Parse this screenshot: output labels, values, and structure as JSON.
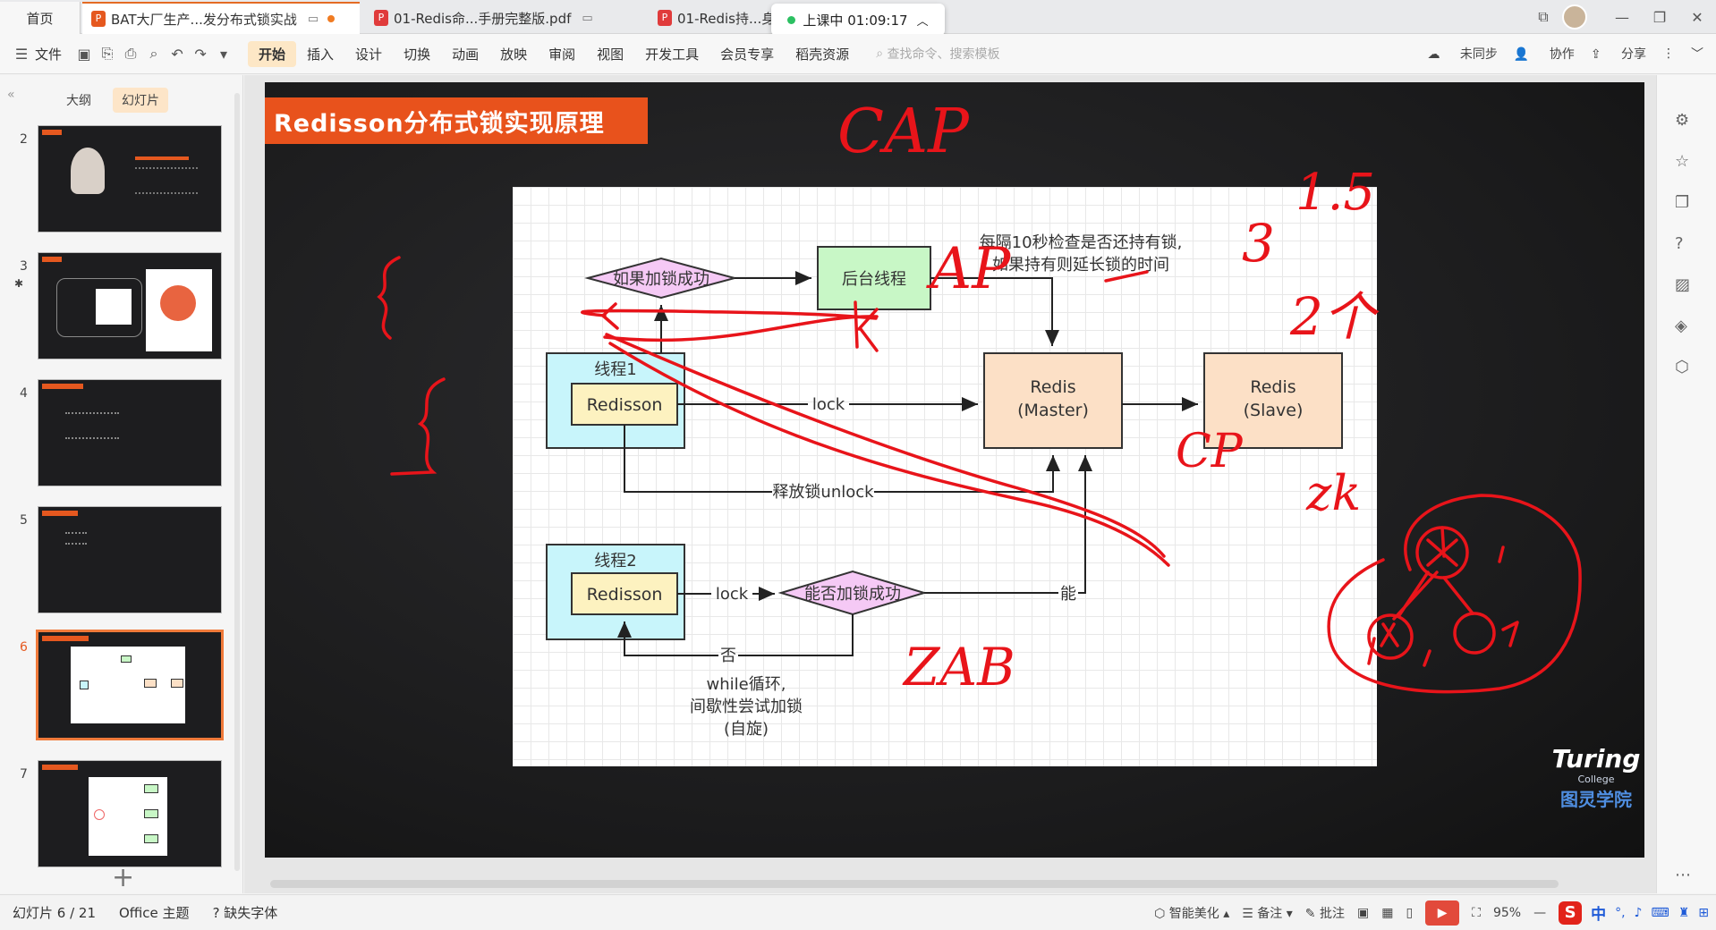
{
  "tabs": {
    "home": "首页",
    "doc1": "BAT大厂生产...发分布式锁实战",
    "doc2": "01-Redis命...手册完整版.pdf",
    "doc3": "01-Redis持...身"
  },
  "class_status": "上课中 01:09:17",
  "ribbon": {
    "file": "文件",
    "items": [
      "开始",
      "插入",
      "设计",
      "切换",
      "动画",
      "放映",
      "审阅",
      "视图",
      "开发工具",
      "会员专享",
      "稻壳资源"
    ],
    "search_placeholder": "查找命令、搜索模板",
    "sync": "未同步",
    "collab": "协作",
    "share": "分享"
  },
  "left_panel": {
    "tab_outline": "大纲",
    "tab_slides": "幻灯片",
    "slide_numbers": [
      "2",
      "3",
      "4",
      "5",
      "6",
      "7"
    ],
    "selected": "6"
  },
  "slide": {
    "title": "Redisson分布式锁实现原理",
    "diagram": {
      "diamond1": "如果加锁成功",
      "bg_thread": "后台线程",
      "note": [
        "每隔10秒检查是否还持有锁,",
        "如果持有则延长锁的时间"
      ],
      "thread1": "线程1",
      "redisson1": "Redisson",
      "lock1": "lock",
      "redis_master_line1": "Redis",
      "redis_master_line2": "(Master)",
      "redis_slave_line1": "Redis",
      "redis_slave_line2": "(Slave)",
      "unlock": "释放锁unlock",
      "thread2": "线程2",
      "redisson2": "Redisson",
      "lock2": "lock",
      "diamond2": "能否加锁成功",
      "can": "能",
      "no": "否",
      "spin": [
        "while循环,",
        "间歇性尝试加锁",
        "(自旋)"
      ]
    },
    "annotations": [
      "CAP",
      "AP",
      "1.5",
      "3",
      "2个",
      "CP",
      "zk",
      "ZAB"
    ],
    "logo": {
      "l1": "Turing",
      "l2": "College",
      "l3": "图灵学院"
    }
  },
  "status": {
    "slide_info": "幻灯片 6 / 21",
    "theme": "Office 主题",
    "font_missing": "缺失字体",
    "beautify": "智能美化",
    "notes": "备注",
    "comments": "批注",
    "zoom": "95%",
    "ime_cn": "中"
  },
  "colors": {
    "accent": "#e8521c",
    "ink": "#e8141a",
    "thread_fill": "#c8f5fb",
    "redisson_fill": "#fdf2c0",
    "diamond_fill": "#f5c9f5",
    "bg_fill": "#c8f7c6",
    "redis_fill": "#fce0c6"
  }
}
